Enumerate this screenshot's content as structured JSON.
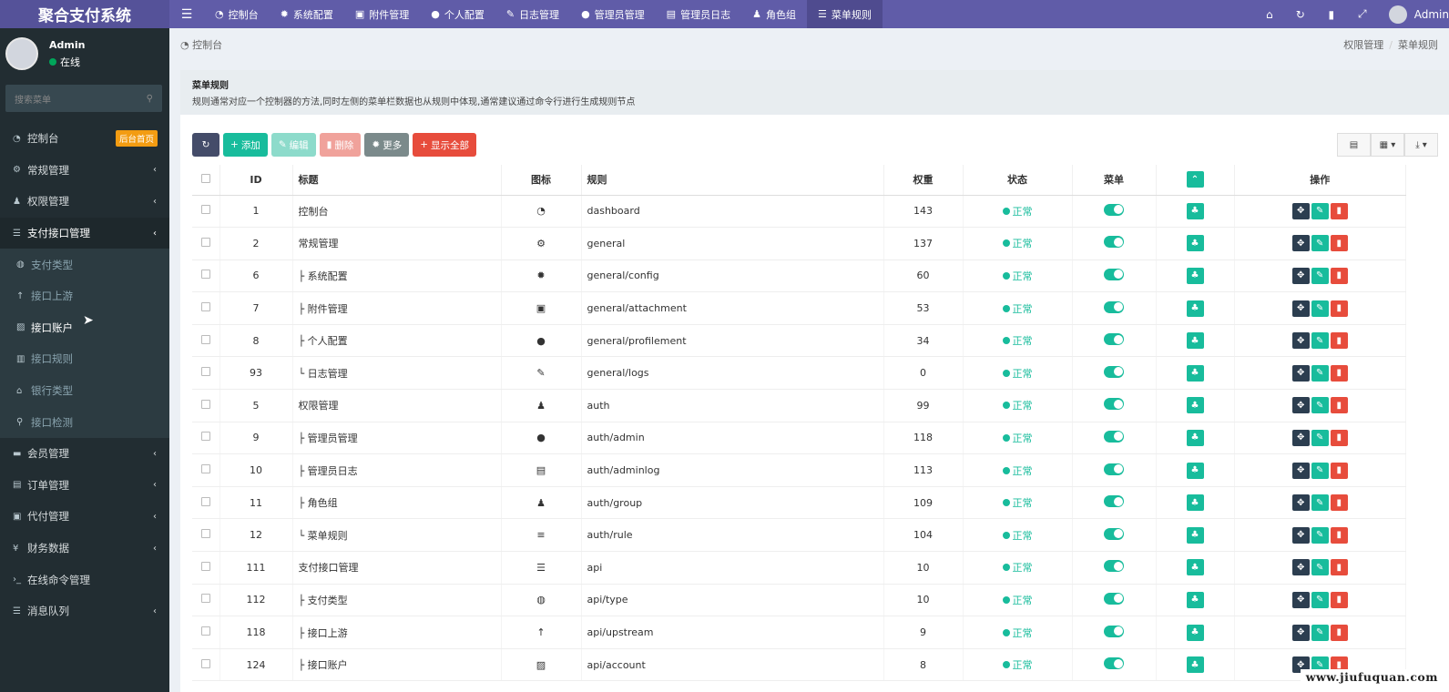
{
  "app": {
    "title": "聚合支付系统"
  },
  "topnav": {
    "toggle_icon": "bars-icon",
    "items": [
      {
        "label": "控制台",
        "icon": "dashboard-icon"
      },
      {
        "label": "系统配置",
        "icon": "cog-icon"
      },
      {
        "label": "附件管理",
        "icon": "image-icon"
      },
      {
        "label": "个人配置",
        "icon": "user-icon"
      },
      {
        "label": "日志管理",
        "icon": "pencil-icon"
      },
      {
        "label": "管理员管理",
        "icon": "user-icon"
      },
      {
        "label": "管理员日志",
        "icon": "list-alt-icon"
      },
      {
        "label": "角色组",
        "icon": "group-icon"
      },
      {
        "label": "菜单规则",
        "icon": "bars-icon"
      }
    ],
    "right_icons": [
      "home-icon",
      "refresh-icon",
      "trash-icon",
      "fullscreen-icon"
    ],
    "user": "Admin"
  },
  "sidebar": {
    "user_name": "Admin",
    "user_status": "在线",
    "search_placeholder": "搜索菜单",
    "items": [
      {
        "label": "控制台",
        "badge": "后台首页"
      },
      {
        "label": "常规管理"
      },
      {
        "label": "权限管理"
      },
      {
        "label": "支付接口管理"
      },
      {
        "label": "会员管理"
      },
      {
        "label": "订单管理"
      },
      {
        "label": "代付管理"
      },
      {
        "label": "财务数据"
      },
      {
        "label": "在线命令管理"
      },
      {
        "label": "消息队列"
      }
    ],
    "subitems": [
      {
        "label": "支付类型"
      },
      {
        "label": "接口上游"
      },
      {
        "label": "接口账户"
      },
      {
        "label": "接口规则"
      },
      {
        "label": "银行类型"
      },
      {
        "label": "接口检测"
      }
    ]
  },
  "breadcrumb": {
    "left": "控制台",
    "right_1": "权限管理",
    "right_2": "菜单规则"
  },
  "panel": {
    "title": "菜单规则",
    "description": "规则通常对应一个控制器的方法,同时左侧的菜单栏数据也从规则中体现,通常建议通过命令行进行生成规则节点"
  },
  "toolbar": {
    "add": "添加",
    "edit": "编辑",
    "delete": "删除",
    "more": "更多",
    "show_all": "显示全部"
  },
  "table": {
    "headers": {
      "id": "ID",
      "title": "标题",
      "icon": "图标",
      "rule": "规则",
      "weight": "权重",
      "status": "状态",
      "menu": "菜单",
      "operate": "操作"
    },
    "rows": [
      {
        "id": "1",
        "title": "控制台",
        "icon": "dashboard-icon",
        "glyph": "◔",
        "rule": "dashboard",
        "weight": "143",
        "status": "正常"
      },
      {
        "id": "2",
        "title": "常规管理",
        "icon": "cogs-icon",
        "glyph": "⚙",
        "rule": "general",
        "weight": "137",
        "status": "正常"
      },
      {
        "id": "6",
        "title": "├ 系统配置",
        "icon": "cog-icon",
        "glyph": "✹",
        "rule": "general/config",
        "weight": "60",
        "status": "正常"
      },
      {
        "id": "7",
        "title": "├ 附件管理",
        "icon": "image-icon",
        "glyph": "▣",
        "rule": "general/attachment",
        "weight": "53",
        "status": "正常"
      },
      {
        "id": "8",
        "title": "├ 个人配置",
        "icon": "user-icon",
        "glyph": "●",
        "rule": "general/profilement",
        "weight": "34",
        "status": "正常"
      },
      {
        "id": "93",
        "title": "└ 日志管理",
        "icon": "pencil-icon",
        "glyph": "✎",
        "rule": "general/logs",
        "weight": "0",
        "status": "正常"
      },
      {
        "id": "5",
        "title": "权限管理",
        "icon": "group-icon",
        "glyph": "♟",
        "rule": "auth",
        "weight": "99",
        "status": "正常"
      },
      {
        "id": "9",
        "title": "├ 管理员管理",
        "icon": "user-icon",
        "glyph": "●",
        "rule": "auth/admin",
        "weight": "118",
        "status": "正常"
      },
      {
        "id": "10",
        "title": "├ 管理员日志",
        "icon": "list-alt-icon",
        "glyph": "▤",
        "rule": "auth/adminlog",
        "weight": "113",
        "status": "正常"
      },
      {
        "id": "11",
        "title": "├ 角色组",
        "icon": "group-icon",
        "glyph": "♟",
        "rule": "auth/group",
        "weight": "109",
        "status": "正常"
      },
      {
        "id": "12",
        "title": "└ 菜单规则",
        "icon": "bars-icon",
        "glyph": "≡",
        "rule": "auth/rule",
        "weight": "104",
        "status": "正常"
      },
      {
        "id": "111",
        "title": "支付接口管理",
        "icon": "list-icon",
        "glyph": "☰",
        "rule": "api",
        "weight": "10",
        "status": "正常"
      },
      {
        "id": "112",
        "title": "├ 支付类型",
        "icon": "globe-icon",
        "glyph": "◍",
        "rule": "api/type",
        "weight": "10",
        "status": "正常"
      },
      {
        "id": "118",
        "title": "├ 接口上游",
        "icon": "arrow-up-icon",
        "glyph": "↑",
        "rule": "api/upstream",
        "weight": "9",
        "status": "正常"
      },
      {
        "id": "124",
        "title": "├ 接口账户",
        "icon": "id-card-icon",
        "glyph": "▨",
        "rule": "api/account",
        "weight": "8",
        "status": "正常"
      }
    ]
  },
  "watermark": "www.jiufuquan.com"
}
